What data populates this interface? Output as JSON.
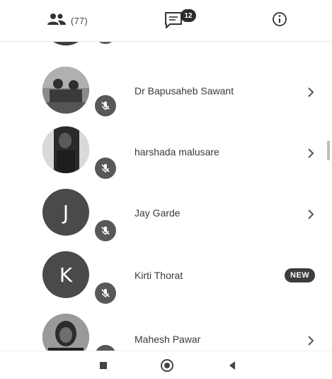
{
  "tabs": {
    "people": {
      "icon": "people-icon",
      "count": "(77)"
    },
    "chat": {
      "icon": "chat-icon",
      "badge": "12"
    },
    "info": {
      "icon": "info-icon"
    }
  },
  "participants": [
    {
      "name": "Dr Bapusaheb Sawant",
      "avatar": "photo",
      "status_icon": "mic-off-icon",
      "action": "chevron-right-icon"
    },
    {
      "name": "harshada malusare",
      "avatar": "photo",
      "status_icon": "mic-off-icon",
      "action": "chevron-right-icon"
    },
    {
      "name": "Jay Garde",
      "avatar": "letter",
      "initial": "J",
      "status_icon": "mic-off-icon",
      "action": "chevron-right-icon"
    },
    {
      "name": "Kirti Thorat",
      "avatar": "letter",
      "initial": "K",
      "status_icon": "mic-off-icon",
      "action": "new-badge",
      "badge": "NEW"
    },
    {
      "name": "Mahesh Pawar",
      "avatar": "photo",
      "status_icon": "mic-off-icon",
      "action": "chevron-right-icon"
    }
  ],
  "system_nav": {
    "recents": "square-icon",
    "home": "circle-icon",
    "back": "back-triangle-icon"
  },
  "colors": {
    "avatar_bg": "#4a4a4a",
    "badge_bg": "#585858",
    "text": "#3a3a3a"
  }
}
